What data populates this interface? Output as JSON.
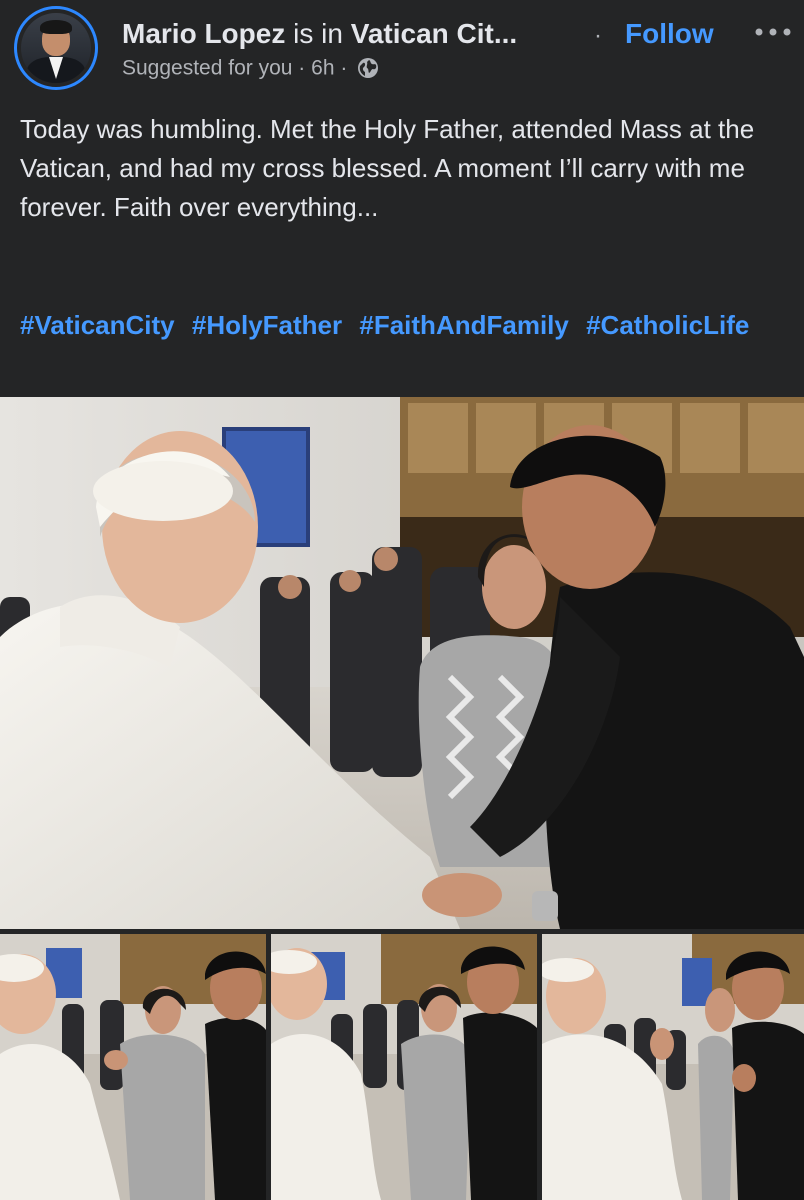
{
  "post": {
    "author": "Mario Lopez",
    "connector": " is in ",
    "location": "Vatican Cit...",
    "follow_label": "Follow",
    "suggested": "Suggested for you",
    "separator": "·",
    "time": "6h",
    "text": "Today was humbling. Met the Holy Father, attended Mass at the Vatican, and had my cross blessed. A moment I’ll carry with me forever. Faith over everything...",
    "hashtags": [
      "#VaticanCity",
      "#HolyFather",
      "#FaithAndFamily",
      "#CatholicLife"
    ]
  },
  "icons": {
    "avatar": "profile-picture",
    "more": "more-options-icon",
    "privacy": "globe-icon"
  },
  "colors": {
    "background": "#242526",
    "link": "#4599ff",
    "secondary_text": "#b0b3b8",
    "avatar_ring": "#2d88ff"
  }
}
